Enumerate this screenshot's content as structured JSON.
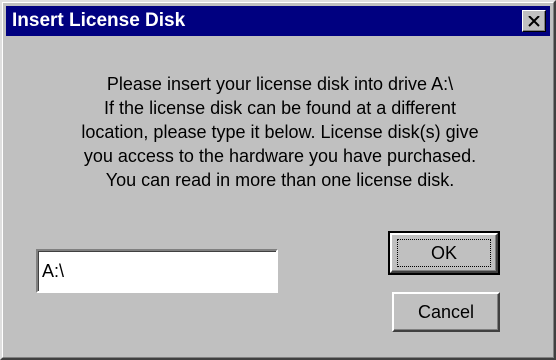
{
  "window": {
    "title": "Insert License Disk",
    "close_icon": "close-x-icon"
  },
  "message": {
    "lines": [
      "Please insert your license disk into drive A:\\",
      "If the license disk can be found at a different",
      "location, please type it below. License disk(s) give",
      "you access to the hardware you have purchased.",
      "You can read in more than one license disk."
    ]
  },
  "path_field": {
    "value": "A:\\"
  },
  "buttons": {
    "ok_label": "OK",
    "cancel_label": "Cancel"
  },
  "colors": {
    "titlebar": "#000080",
    "face": "#c0c0c0"
  }
}
